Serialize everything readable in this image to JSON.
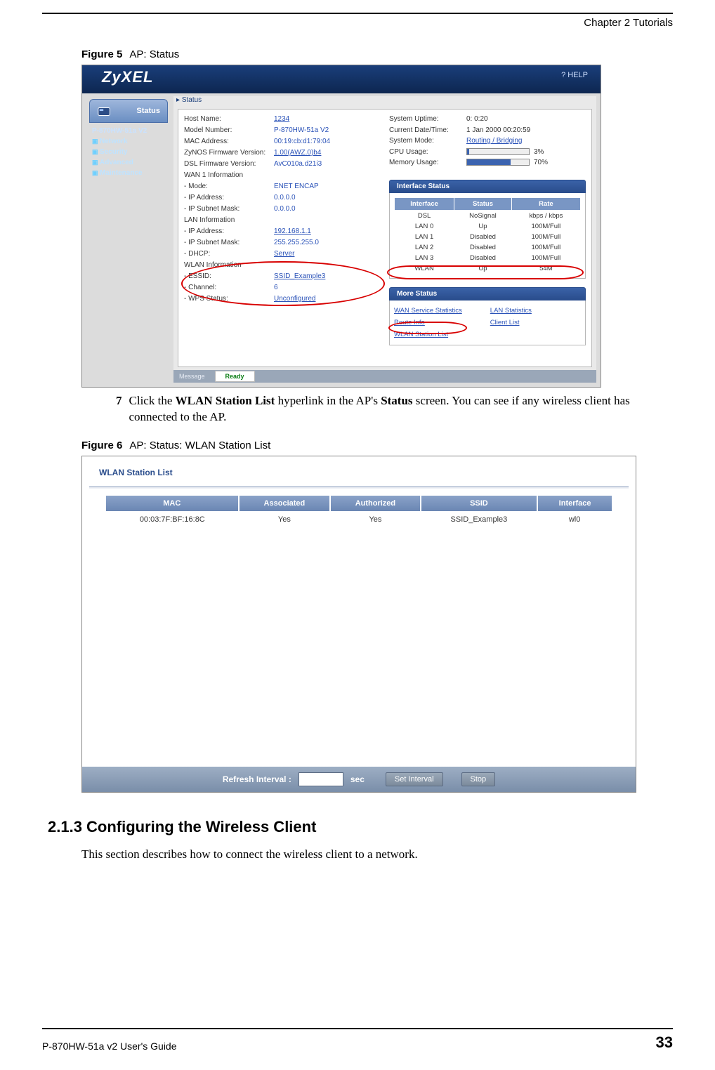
{
  "doc": {
    "chapter_header": "Chapter 2 Tutorials",
    "footer_guide": "P-870HW-51a v2 User's Guide",
    "page_number": "33"
  },
  "figure5": {
    "caption_label": "Figure 5",
    "caption_text": "AP: Status",
    "logo": "ZyXEL",
    "help": "? HELP",
    "status_tab": "Status",
    "model": "P-870HW-51a V2",
    "nav": [
      "Network",
      "Security",
      "Advanced",
      "Maintenance"
    ],
    "status_crumb": "Status",
    "msg_label": "Message",
    "ready": "Ready",
    "left_rows": [
      {
        "label": "Host Name:",
        "value": "1234",
        "link": true
      },
      {
        "label": "Model Number:",
        "value": "P-870HW-51a V2"
      },
      {
        "label": "MAC Address:",
        "value": "00:19:cb:d1:79:04"
      },
      {
        "label": "ZyNOS Firmware Version:",
        "value": "1.00(AWZ.0)b4",
        "link": true
      },
      {
        "label": "DSL Firmware Version:",
        "value": "AvC010a.d21i3"
      },
      {
        "label": "WAN 1 Information",
        "value": ""
      },
      {
        "label": "  - Mode:",
        "value": "ENET ENCAP"
      },
      {
        "label": "  - IP Address:",
        "value": "0.0.0.0"
      },
      {
        "label": "  - IP Subnet Mask:",
        "value": "0.0.0.0"
      },
      {
        "label": "LAN Information",
        "value": ""
      },
      {
        "label": "  - IP Address:",
        "value": "192.168.1.1",
        "link": true
      },
      {
        "label": "  - IP Subnet Mask:",
        "value": "255.255.255.0"
      },
      {
        "label": "  - DHCP:",
        "value": "Server",
        "link": true
      },
      {
        "label": "WLAN Information",
        "value": ""
      },
      {
        "label": "  - ESSID:",
        "value": "SSID_Example3",
        "link": true
      },
      {
        "label": "  - Channel:",
        "value": "6"
      },
      {
        "label": "  - WPS Status:",
        "value": "Unconfigured",
        "link": true
      }
    ],
    "right_rows": [
      {
        "label": "System Uptime:",
        "value": "0: 0:20"
      },
      {
        "label": "Current Date/Time:",
        "value": "1 Jan 2000 00:20:59"
      },
      {
        "label": "System Mode:",
        "value": "Routing / Bridging",
        "link": true
      },
      {
        "label": "CPU Usage:",
        "bar": 3,
        "value": "3%"
      },
      {
        "label": "Memory Usage:",
        "bar": 70,
        "value": "70%"
      }
    ],
    "iface_header": "Interface Status",
    "iface_cols": [
      "Interface",
      "Status",
      "Rate"
    ],
    "iface_rows": [
      [
        "DSL",
        "NoSignal",
        "kbps / kbps"
      ],
      [
        "LAN 0",
        "Up",
        "100M/Full"
      ],
      [
        "LAN 1",
        "Disabled",
        "100M/Full"
      ],
      [
        "LAN 2",
        "Disabled",
        "100M/Full"
      ],
      [
        "LAN 3",
        "Disabled",
        "100M/Full"
      ],
      [
        "WLAN",
        "Up",
        "54M"
      ]
    ],
    "more_header": "More Status",
    "more_links_left": [
      "WAN Service Statistics",
      "Route Info",
      "WLAN Station List"
    ],
    "more_links_right": [
      "LAN Statistics",
      "Client List"
    ]
  },
  "step": {
    "num": "7",
    "text_pre": "Click the ",
    "bold1": "WLAN Station List",
    "text_mid": " hyperlink in the AP's ",
    "bold2": "Status",
    "text_post": " screen. You can see if any wireless client has connected to the AP."
  },
  "figure6": {
    "caption_label": "Figure 6",
    "caption_text": "AP: Status: WLAN Station List",
    "panel_title": "WLAN Station List",
    "cols": [
      "MAC",
      "Associated",
      "Authorized",
      "SSID",
      "Interface"
    ],
    "row": [
      "00:03:7F:BF:16:8C",
      "Yes",
      "Yes",
      "SSID_Example3",
      "wl0"
    ],
    "refresh_label": "Refresh Interval :",
    "sec_label": "sec",
    "btn_set": "Set Interval",
    "btn_stop": "Stop"
  },
  "section": {
    "heading": "2.1.3  Configuring the Wireless Client",
    "para": "This section describes how to connect the wireless client to a network."
  }
}
